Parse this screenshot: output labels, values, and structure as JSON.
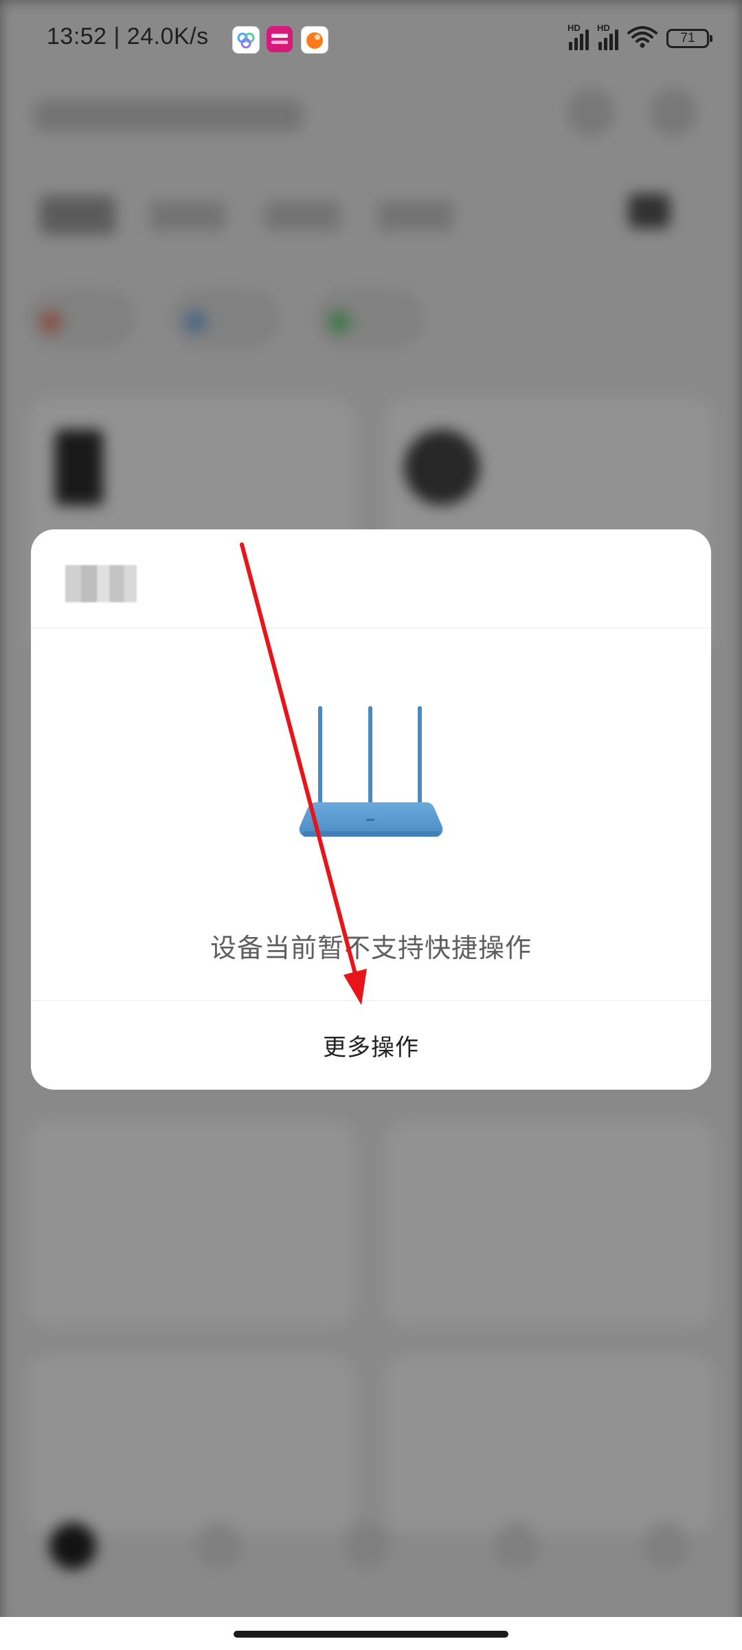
{
  "status_bar": {
    "time": "13:52 | 24.0K/s",
    "network_type_1": "HD",
    "network_type_2": "HD",
    "battery": "71",
    "icons": [
      "app-notification-icon-cloud",
      "app-notification-icon-vipshop",
      "app-notification-icon-orange",
      "signal-icon",
      "signal-icon",
      "wifi-icon",
      "battery-icon"
    ]
  },
  "dialog": {
    "device_name": "",
    "device_icon": "router-icon",
    "message": "设备当前暂不支持快捷操作",
    "more_actions_label": "更多操作"
  },
  "colors": {
    "router": "#5b9bd0",
    "annotation_arrow": "#e8141a",
    "scrim": "rgba(0,0,0,0.42)"
  }
}
